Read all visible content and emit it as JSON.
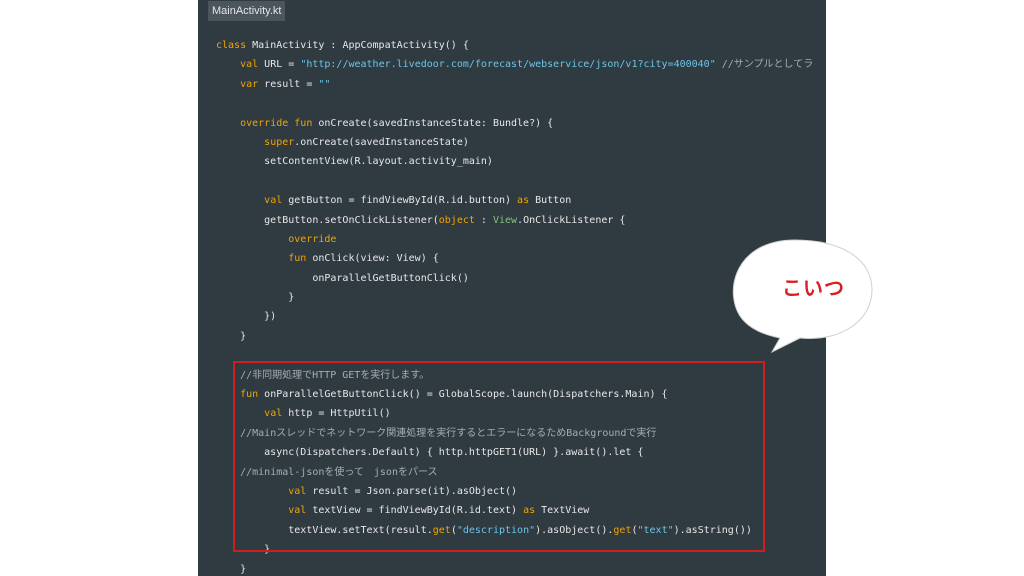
{
  "tab": {
    "title": "MainActivity.kt"
  },
  "code": {
    "lines": [
      [
        [
          "class MainActivity : AppCompatActivity() {",
          "kw:class"
        ]
      ],
      [
        [
          "    ",
          ""
        ],
        [
          "val",
          "kw"
        ],
        [
          " URL = ",
          ""
        ],
        [
          "\"http://weather.livedoor.com/forecast/webservice/json/v1?city=400040\"",
          "str"
        ],
        [
          " //サンプルとしてラ",
          "cm"
        ]
      ],
      [
        [
          "    ",
          ""
        ],
        [
          "var",
          "kw"
        ],
        [
          " result = ",
          ""
        ],
        [
          "\"\"",
          "str"
        ]
      ],
      [
        [
          "",
          ""
        ]
      ],
      [
        [
          "    ",
          ""
        ],
        [
          "override fun",
          "kw"
        ],
        [
          " onCreate(savedInstanceState: Bundle?) {",
          ""
        ]
      ],
      [
        [
          "        ",
          ""
        ],
        [
          "super",
          "kw"
        ],
        [
          ".onCreate(savedInstanceState)",
          ""
        ]
      ],
      [
        [
          "        setContentView(R.layout.activity_main)",
          ""
        ]
      ],
      [
        [
          "",
          ""
        ]
      ],
      [
        [
          "        ",
          ""
        ],
        [
          "val",
          "kw"
        ],
        [
          " getButton = findViewById(R.id.button) ",
          ""
        ],
        [
          "as",
          "kw"
        ],
        [
          " Button",
          ""
        ]
      ],
      [
        [
          "        getButton.setOnClickListener(",
          ""
        ],
        [
          "object",
          "kw"
        ],
        [
          " : ",
          ""
        ],
        [
          "View",
          "typ"
        ],
        [
          ".OnClickListener {",
          ""
        ]
      ],
      [
        [
          "            ",
          ""
        ],
        [
          "override",
          "kw"
        ]
      ],
      [
        [
          "            ",
          ""
        ],
        [
          "fun",
          "kw"
        ],
        [
          " onClick(view: View) {",
          ""
        ]
      ],
      [
        [
          "                onParallelGetButtonClick()",
          ""
        ]
      ],
      [
        [
          "            }",
          ""
        ]
      ],
      [
        [
          "        })",
          ""
        ]
      ],
      [
        [
          "    }",
          ""
        ]
      ],
      [
        [
          "",
          ""
        ]
      ],
      [
        [
          "    ",
          ""
        ],
        [
          "//非同期処理でHTTP GETを実行します。",
          "cm"
        ]
      ],
      [
        [
          "    ",
          ""
        ],
        [
          "fun",
          "kw"
        ],
        [
          " onParallelGetButtonClick() = GlobalScope.launch(Dispatchers.Main) {",
          ""
        ]
      ],
      [
        [
          "        ",
          ""
        ],
        [
          "val",
          "kw"
        ],
        [
          " http = HttpUtil()",
          ""
        ]
      ],
      [
        [
          "    ",
          ""
        ],
        [
          "//Mainスレッドでネットワーク関連処理を実行するとエラーになるためBackgroundで実行",
          "cm"
        ]
      ],
      [
        [
          "        async(Dispatchers.Default) { http.httpGET1(URL) }.await().let {",
          ""
        ]
      ],
      [
        [
          "    ",
          ""
        ],
        [
          "//minimal-jsonを使って　jsonをパース",
          "cm"
        ]
      ],
      [
        [
          "            ",
          ""
        ],
        [
          "val",
          "kw"
        ],
        [
          " result = Json.parse(it).asObject()",
          ""
        ]
      ],
      [
        [
          "            ",
          ""
        ],
        [
          "val",
          "kw"
        ],
        [
          " textView = findViewById(R.id.text) ",
          ""
        ],
        [
          "as",
          "kw"
        ],
        [
          " TextView",
          ""
        ]
      ],
      [
        [
          "            textView.setText(result.",
          ""
        ],
        [
          "get",
          "kw"
        ],
        [
          "(",
          ""
        ],
        [
          "\"description\"",
          "str"
        ],
        [
          ").asObject().",
          ""
        ],
        [
          "get",
          "kw"
        ],
        [
          "(",
          ""
        ],
        [
          "\"text\"",
          "str"
        ],
        [
          ").asString())",
          ""
        ]
      ],
      [
        [
          "        }",
          ""
        ]
      ],
      [
        [
          "    }",
          ""
        ]
      ]
    ]
  },
  "callout": {
    "text": "こいつ"
  },
  "colors": {
    "editor_bg": "#2f3a41",
    "keyword": "#f0a500",
    "string": "#6cc5e8",
    "comment": "#a6adb3",
    "highlight_border": "#cc1f1f",
    "callout_text": "#d81e1e"
  }
}
